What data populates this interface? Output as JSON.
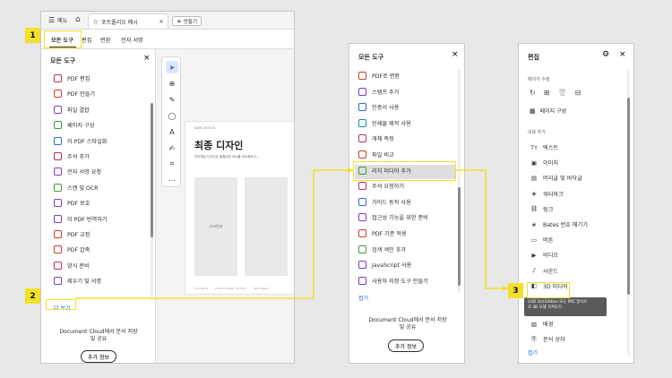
{
  "window1": {
    "menu_label": "메뉴",
    "tab_title": "포트폴리오 예시",
    "new_tab_label": "만들기",
    "toolbar_tabs": [
      "모든 도구",
      "편집",
      "변환",
      "전자 서명"
    ],
    "panel_title": "모든 도구",
    "items": [
      {
        "label": "PDF 편집",
        "color": "pink"
      },
      {
        "label": "PDF 만들기",
        "color": "red"
      },
      {
        "label": "파일 결합",
        "color": "purple"
      },
      {
        "label": "페이지 구성",
        "color": "green"
      },
      {
        "label": "이 PDF 스타일화",
        "color": "blue"
      },
      {
        "label": "주석 추가",
        "color": "pink"
      },
      {
        "label": "전자 서명 요청",
        "color": "purple"
      },
      {
        "label": "스캔 및 OCR",
        "color": "green"
      },
      {
        "label": "PDF 보호",
        "color": "purple"
      },
      {
        "label": "이 PDF 번역하기",
        "color": "purple"
      },
      {
        "label": "PDF 교정",
        "color": "red"
      },
      {
        "label": "PDF 압축",
        "color": "red"
      },
      {
        "label": "양식 준비",
        "color": "pink"
      },
      {
        "label": "제우기 및 서명",
        "color": "purple"
      }
    ],
    "more_link": "더 보기",
    "cloud_text_1": "Document Cloud에서 문서 저장",
    "cloud_text_2": "및 공유",
    "info_button": "추가 정보",
    "doc_kicker": "NAMU DESIGN",
    "doc_heading": "최종 디자인",
    "doc_sub": "인더에센 디자인은 불필요한 요소를 최소화하고…",
    "doc_placeholder": "스크린샷",
    "doc_footer": [
      "Your Name",
      "Product Design / Portfolio",
      "Work Name"
    ],
    "badge": "1"
  },
  "badge2": "2",
  "window2": {
    "panel_title": "모든 도구",
    "items": [
      {
        "label": "PDF로 변환",
        "color": "red"
      },
      {
        "label": "스탬프 추가",
        "color": "purple"
      },
      {
        "label": "인증서 사용",
        "color": "blue"
      },
      {
        "label": "인쇄물 제작 사용",
        "color": "teal"
      },
      {
        "label": "개체 측정",
        "color": "pink"
      },
      {
        "label": "파일 비교",
        "color": "red"
      },
      {
        "label": "리치 미디어 추가",
        "color": "green"
      },
      {
        "label": "주석 요청하기",
        "color": "pink"
      },
      {
        "label": "가이드 동작 사용",
        "color": "blue"
      },
      {
        "label": "접근성 기능을 위한 준비",
        "color": "purple"
      },
      {
        "label": "PDF 기준 적용",
        "color": "red"
      },
      {
        "label": "검색 색인 추가",
        "color": "green"
      },
      {
        "label": "JavaScript 사용",
        "color": "purple"
      },
      {
        "label": "사용자 지정 도구 만들기",
        "color": "purple"
      }
    ],
    "collapse_link": "접기",
    "cloud_text_1": "Document Cloud에서 문서 저장",
    "cloud_text_2": "및 공유",
    "info_button": "추가 정보"
  },
  "window3": {
    "panel_title": "편집",
    "section_pages": "페이지 수정",
    "page_org": "페이지 구성",
    "section_content": "내용 추가",
    "items": [
      {
        "label": "텍스트",
        "icon": "text-icon"
      },
      {
        "label": "이미지",
        "icon": "image-icon"
      },
      {
        "label": "머리글 및 바닥글",
        "icon": "header-footer-icon"
      },
      {
        "label": "워터마크",
        "icon": "watermark-icon"
      },
      {
        "label": "링크",
        "icon": "link-icon"
      },
      {
        "label": "Bates 번호 매기기",
        "icon": "bates-icon"
      },
      {
        "label": "버튼",
        "icon": "button-icon"
      },
      {
        "label": "비디오",
        "icon": "video-icon"
      },
      {
        "label": "사운드",
        "icon": "sound-icon"
      },
      {
        "label": "3D 미디어",
        "icon": "3d-icon"
      }
    ],
    "tooltip_1": "U3D 3rd Edition 또는 PRC 형식으",
    "tooltip_2": "로 3D 모델 가져오기",
    "after_items": [
      {
        "label": "배경",
        "icon": "background-icon"
      },
      {
        "label": "문서 상자",
        "icon": "text-box-icon"
      }
    ],
    "collapse_link": "접기",
    "badge": "3"
  },
  "colors": {
    "accent_yellow": "#f2e02a",
    "link_blue": "#2a6ad6",
    "selected_bg": "#dedede"
  }
}
